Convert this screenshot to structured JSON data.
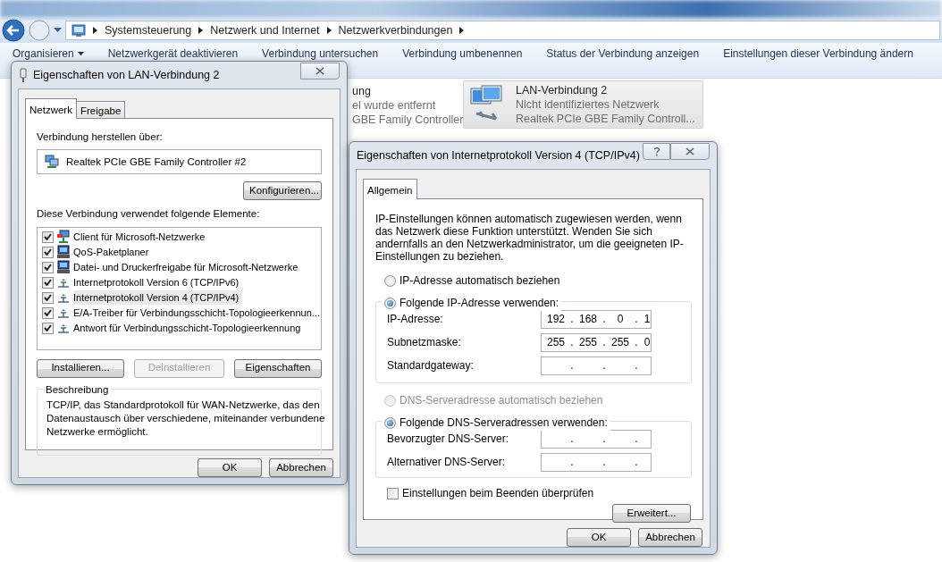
{
  "explorer": {
    "breadcrumb": [
      "Systemsteuerung",
      "Netzwerk und Internet",
      "Netzwerkverbindungen"
    ],
    "toolbar": [
      {
        "label": "Organisieren",
        "kind": "menu"
      },
      {
        "label": "Netzwerkgerät deaktivieren",
        "kind": "plain"
      },
      {
        "label": "Verbindung untersuchen",
        "kind": "plain"
      },
      {
        "label": "Verbindung umbenennen",
        "kind": "plain"
      },
      {
        "label": "Status der Verbindung anzeigen",
        "kind": "plain"
      },
      {
        "label": "Einstellungen dieser Verbindung ändern",
        "kind": "plain"
      }
    ],
    "connections": [
      {
        "lines": [
          "ung",
          "el wurde entfernt",
          "GBE Family Controller"
        ],
        "selected": false
      },
      {
        "lines": [
          "LAN-Verbindung 2",
          "Nicht identifiziertes Netzwerk",
          "Realtek PCIe GBE Family Controll..."
        ],
        "selected": true
      }
    ]
  },
  "lan_dialog": {
    "title": "Eigenschaften von LAN-Verbindung 2",
    "tabs": [
      {
        "label": "Netzwerk",
        "selected": true
      },
      {
        "label": "Freigabe",
        "selected": false
      }
    ],
    "connect_label": "Verbindung herstellen über:",
    "adapter": "Realtek PCIe GBE Family Controller #2",
    "configure_button": "Konfigurieren...",
    "elements_label": "Diese Verbindung verwendet folgende Elemente:",
    "elements": [
      {
        "label": "Client für Microsoft-Netzwerke",
        "kind": "client",
        "checked": true,
        "selected": false
      },
      {
        "label": "QoS-Paketplaner",
        "kind": "service",
        "checked": true,
        "selected": false
      },
      {
        "label": "Datei- und Druckerfreigabe für Microsoft-Netzwerke",
        "kind": "service",
        "checked": true,
        "selected": false
      },
      {
        "label": "Internetprotokoll Version 6 (TCP/IPv6)",
        "kind": "protocol",
        "checked": true,
        "selected": false
      },
      {
        "label": "Internetprotokoll Version 4 (TCP/IPv4)",
        "kind": "protocol",
        "checked": true,
        "selected": true
      },
      {
        "label": "E/A-Treiber für Verbindungsschicht-Topologieerkennun...",
        "kind": "protocol",
        "checked": true,
        "selected": false
      },
      {
        "label": "Antwort für Verbindungsschicht-Topologieerkennung",
        "kind": "protocol",
        "checked": true,
        "selected": false
      }
    ],
    "buttons": [
      {
        "label": "Installieren...",
        "disabled": false
      },
      {
        "label": "Deinstallieren",
        "disabled": true
      },
      {
        "label": "Eigenschaften",
        "disabled": false
      }
    ],
    "description_legend": "Beschreibung",
    "description": "TCP/IP, das Standardprotokoll für WAN-Netzwerke, das den Datenaustausch über verschiedene, miteinander verbundene Netzwerke ermöglicht.",
    "footer_buttons": [
      "OK",
      "Abbrechen"
    ]
  },
  "ipv4_dialog": {
    "title": "Eigenschaften von Internetprotokoll Version 4 (TCP/IPv4)",
    "tabs": [
      {
        "label": "Allgemein",
        "selected": true
      }
    ],
    "intro": "IP-Einstellungen können automatisch zugewiesen werden, wenn das Netzwerk diese Funktion unterstützt. Wenden Sie sich andernfalls an den Netzwerkadministrator, um die geeigneten IP-Einstellungen zu beziehen.",
    "ip_auto": {
      "label": "IP-Adresse automatisch beziehen",
      "selected": false,
      "disabled": false
    },
    "ip_manual": {
      "label": "Folgende IP-Adresse verwenden:",
      "selected": true,
      "disabled": false
    },
    "ip_fields": [
      {
        "label": "IP-Adresse:",
        "value": "192 . 168 . 0 . 1"
      },
      {
        "label": "Subnetzmaske:",
        "value": "255 . 255 . 255 . 0"
      },
      {
        "label": "Standardgateway:",
        "value": ". . ."
      }
    ],
    "dns_auto": {
      "label": "DNS-Serveradresse automatisch beziehen",
      "selected": false,
      "disabled": true
    },
    "dns_manual": {
      "label": "Folgende DNS-Serveradressen verwenden:",
      "selected": true,
      "disabled": false
    },
    "dns_fields": [
      {
        "label": "Bevorzugter DNS-Server:",
        "value": ". . ."
      },
      {
        "label": "Alternativer DNS-Server:",
        "value": ". . ."
      }
    ],
    "validate": {
      "label": "Einstellungen beim Beenden überprüfen",
      "checked": false
    },
    "advanced_button": "Erweitert...",
    "footer_buttons": [
      "OK",
      "Abbrechen"
    ]
  }
}
